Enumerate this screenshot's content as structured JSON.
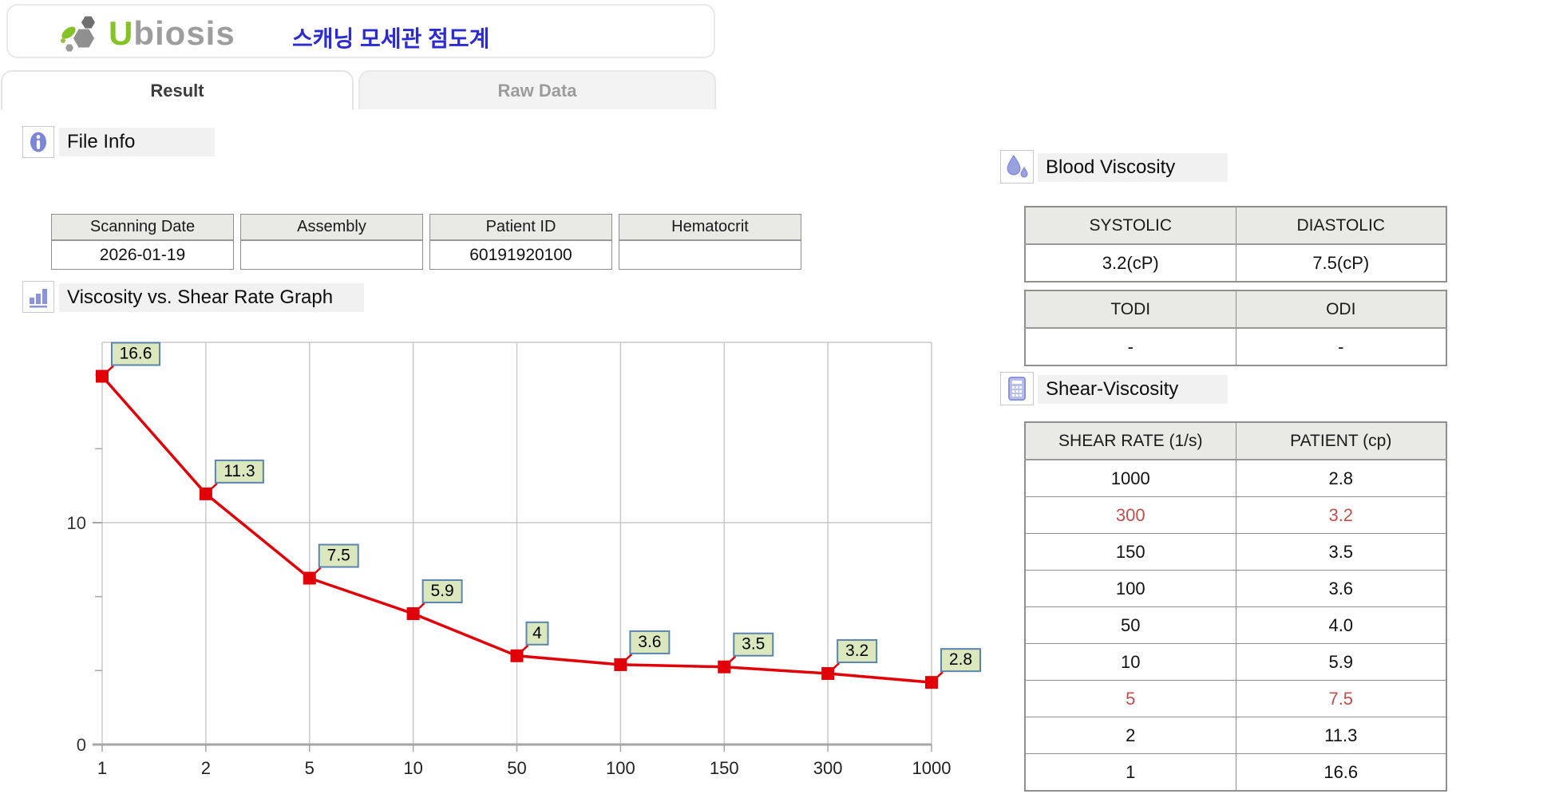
{
  "header": {
    "logo_text": "Ubiosis",
    "app_title_korean": "스캐닝 모세관 점도계"
  },
  "tabs": [
    {
      "label": "Result",
      "active": true
    },
    {
      "label": "Raw Data",
      "active": false
    }
  ],
  "file_info": {
    "section_title": "File Info",
    "fields": [
      {
        "label": "Scanning Date",
        "value": "2026-01-19"
      },
      {
        "label": "Assembly",
        "value": ""
      },
      {
        "label": "Patient ID",
        "value": "60191920100"
      },
      {
        "label": "Hematocrit",
        "value": ""
      }
    ]
  },
  "graph_section": {
    "section_title": "Viscosity vs. Shear Rate Graph"
  },
  "chart_data": {
    "type": "line",
    "title": "Viscosity vs. Shear Rate Graph",
    "categories": [
      "1",
      "2",
      "5",
      "10",
      "50",
      "100",
      "150",
      "300",
      "1000"
    ],
    "series": [
      {
        "name": "PATIENT",
        "values": [
          16.6,
          11.3,
          7.5,
          5.9,
          4,
          3.6,
          3.5,
          3.2,
          2.8
        ]
      }
    ],
    "point_labels": [
      "16.6",
      "11.3",
      "7.5",
      "5.9",
      "4",
      "3.6",
      "3.5",
      "3.2",
      "2.8"
    ],
    "xlabel": "",
    "ylabel": "",
    "ylim": [
      0,
      18
    ],
    "yticks_labeled": [
      0,
      10
    ],
    "yticks_minor": [
      3.333,
      6.667,
      13.333,
      16.667
    ],
    "grid": "on",
    "legend": "none",
    "line_color": "#e10008",
    "marker": "square",
    "label_box_fill": "#dbe7bd",
    "label_box_border": "#5b84b1",
    "grid_color": "#c9c9c9",
    "axis_color": "#a6a6a6"
  },
  "blood_viscosity": {
    "section_title": "Blood Viscosity",
    "pressure_table": {
      "headers": [
        "SYSTOLIC",
        "DIASTOLIC"
      ],
      "values": [
        "3.2(cP)",
        "7.5(cP)"
      ]
    },
    "index_table": {
      "headers": [
        "TODI",
        "ODI"
      ],
      "values": [
        "-",
        "-"
      ]
    }
  },
  "shear_viscosity": {
    "section_title": "Shear-Viscosity",
    "headers": [
      "SHEAR RATE (1/s)",
      "PATIENT (cp)"
    ],
    "rows": [
      {
        "shear_rate": "1000",
        "patient": "2.8",
        "highlight": false
      },
      {
        "shear_rate": "300",
        "patient": "3.2",
        "highlight": true
      },
      {
        "shear_rate": "150",
        "patient": "3.5",
        "highlight": false
      },
      {
        "shear_rate": "100",
        "patient": "3.6",
        "highlight": false
      },
      {
        "shear_rate": "50",
        "patient": "4.0",
        "highlight": false
      },
      {
        "shear_rate": "10",
        "patient": "5.9",
        "highlight": false
      },
      {
        "shear_rate": "5",
        "patient": "7.5",
        "highlight": true
      },
      {
        "shear_rate": "2",
        "patient": "11.3",
        "highlight": false
      },
      {
        "shear_rate": "1",
        "patient": "16.6",
        "highlight": false
      }
    ],
    "highlight_color": "#c0504d"
  }
}
